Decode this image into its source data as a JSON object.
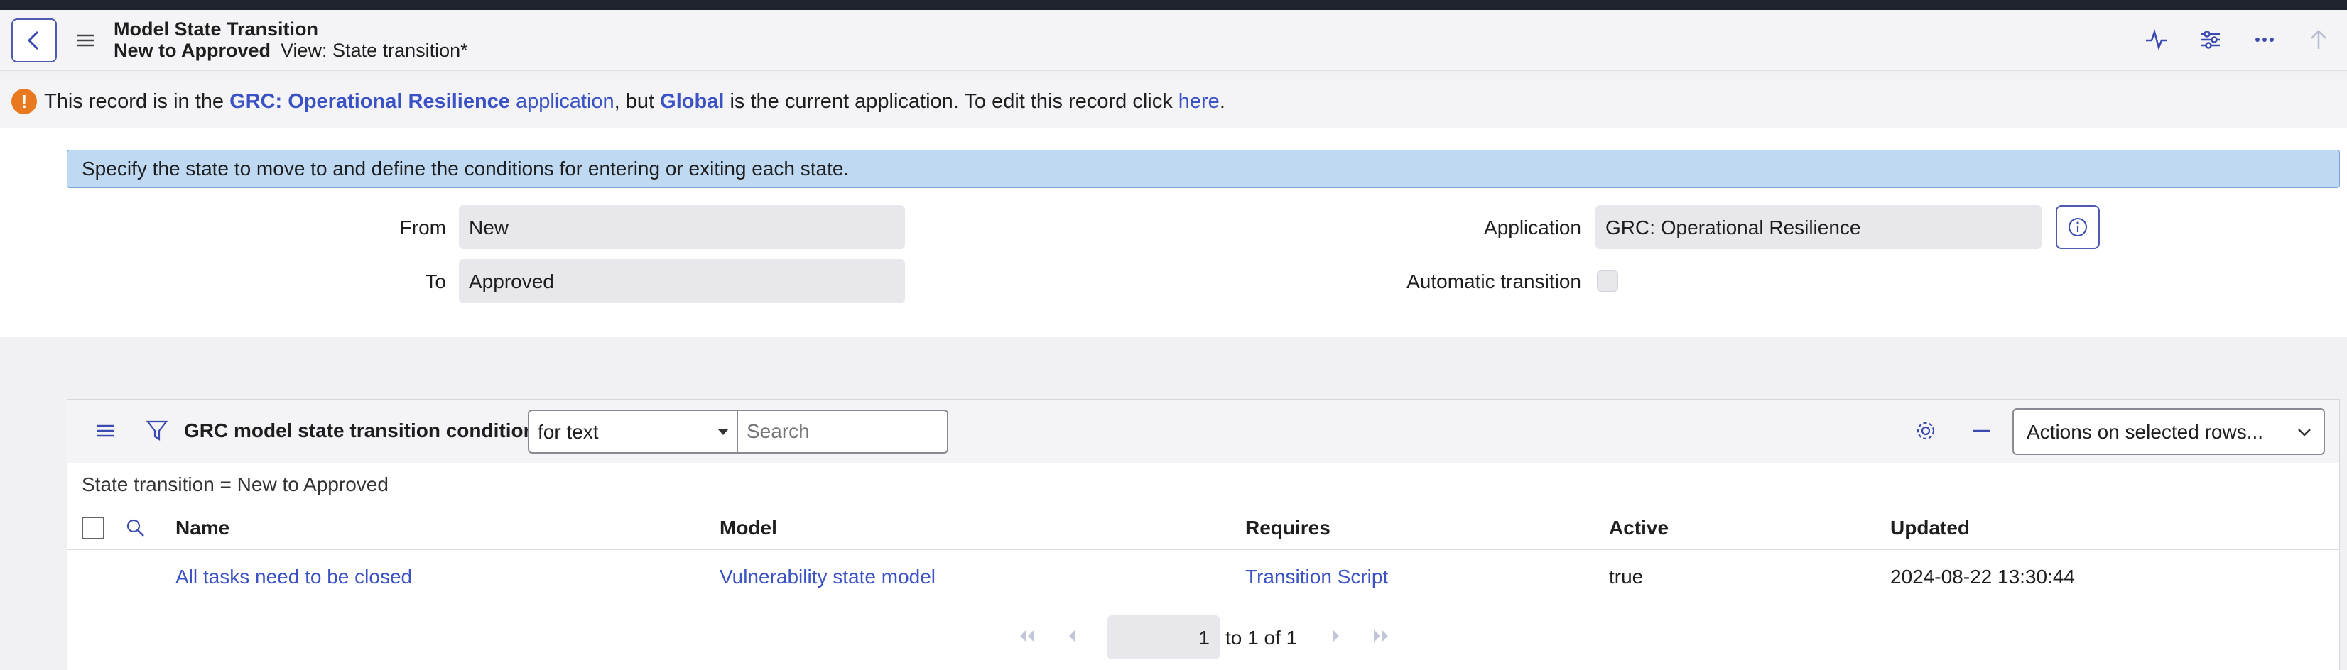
{
  "header": {
    "title": "Model State Transition",
    "record": "New to Approved",
    "view": "View: State transition*"
  },
  "notice": {
    "part1": "This record is in the ",
    "app_name": "GRC: Operational Resilience",
    "app_word": " application",
    "part2": ", but ",
    "current_app": "Global",
    "part3": " is the current application. To edit this record click ",
    "link": "here",
    "part4": "."
  },
  "form": {
    "info": "Specify the state to move to and define the conditions for entering or exiting each state.",
    "from_label": "From",
    "from_value": "New",
    "to_label": "To",
    "to_value": "Approved",
    "application_label": "Application",
    "application_value": "GRC: Operational Resilience",
    "auto_label": "Automatic transition"
  },
  "list": {
    "title": "GRC model state transition conditions",
    "filter_select": "for text",
    "search_placeholder": "Search",
    "actions": "Actions on selected rows...",
    "breadcrumb": "State transition = New to Approved",
    "columns": [
      "Name",
      "Model",
      "Requires",
      "Active",
      "Updated"
    ],
    "rows": [
      [
        "All tasks need to be closed",
        "Vulnerability state model",
        "Transition Script",
        "true",
        "2024-08-22 13:30:44"
      ]
    ],
    "pager": {
      "page": "1",
      "text": "to 1 of 1"
    }
  },
  "colors": {
    "accent": "#3a52c4",
    "info_bar": "#bfd9f2",
    "warning": "#e8791f"
  }
}
